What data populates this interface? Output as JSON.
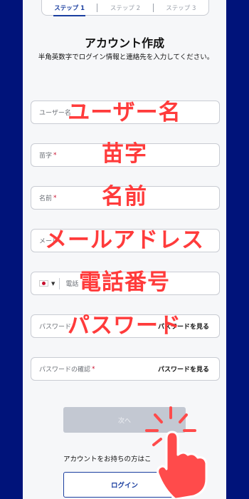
{
  "stepper": {
    "steps": [
      "ステップ 1",
      "ステップ 2",
      "ステップ 3"
    ]
  },
  "header": {
    "title": "アカウント作成",
    "subtitle": "半角英数字でログイン情報と連絡先を入力してください。"
  },
  "form": {
    "username_placeholder": "ユーザー名",
    "lastname_label": "苗字",
    "firstname_label": "名前",
    "email_placeholder": "メール",
    "phone_placeholder": "電話",
    "password_label": "パスワード",
    "password_confirm_label": "パスワードの確認",
    "required_mark": "*",
    "show_password_label": "パスワードを見る"
  },
  "overlays": [
    "ユーザー名",
    "苗字",
    "名前",
    "メールアドレス",
    "電話番号",
    "パスワード"
  ],
  "actions": {
    "next_label": "次へ",
    "have_account_text": "アカウントをお持ちの方はこ",
    "login_label": "ログイン"
  },
  "colors": {
    "background": "#00137a",
    "accent": "#1b3fa0",
    "overlay_text": "#ff3b3b",
    "required": "#c8102e"
  }
}
